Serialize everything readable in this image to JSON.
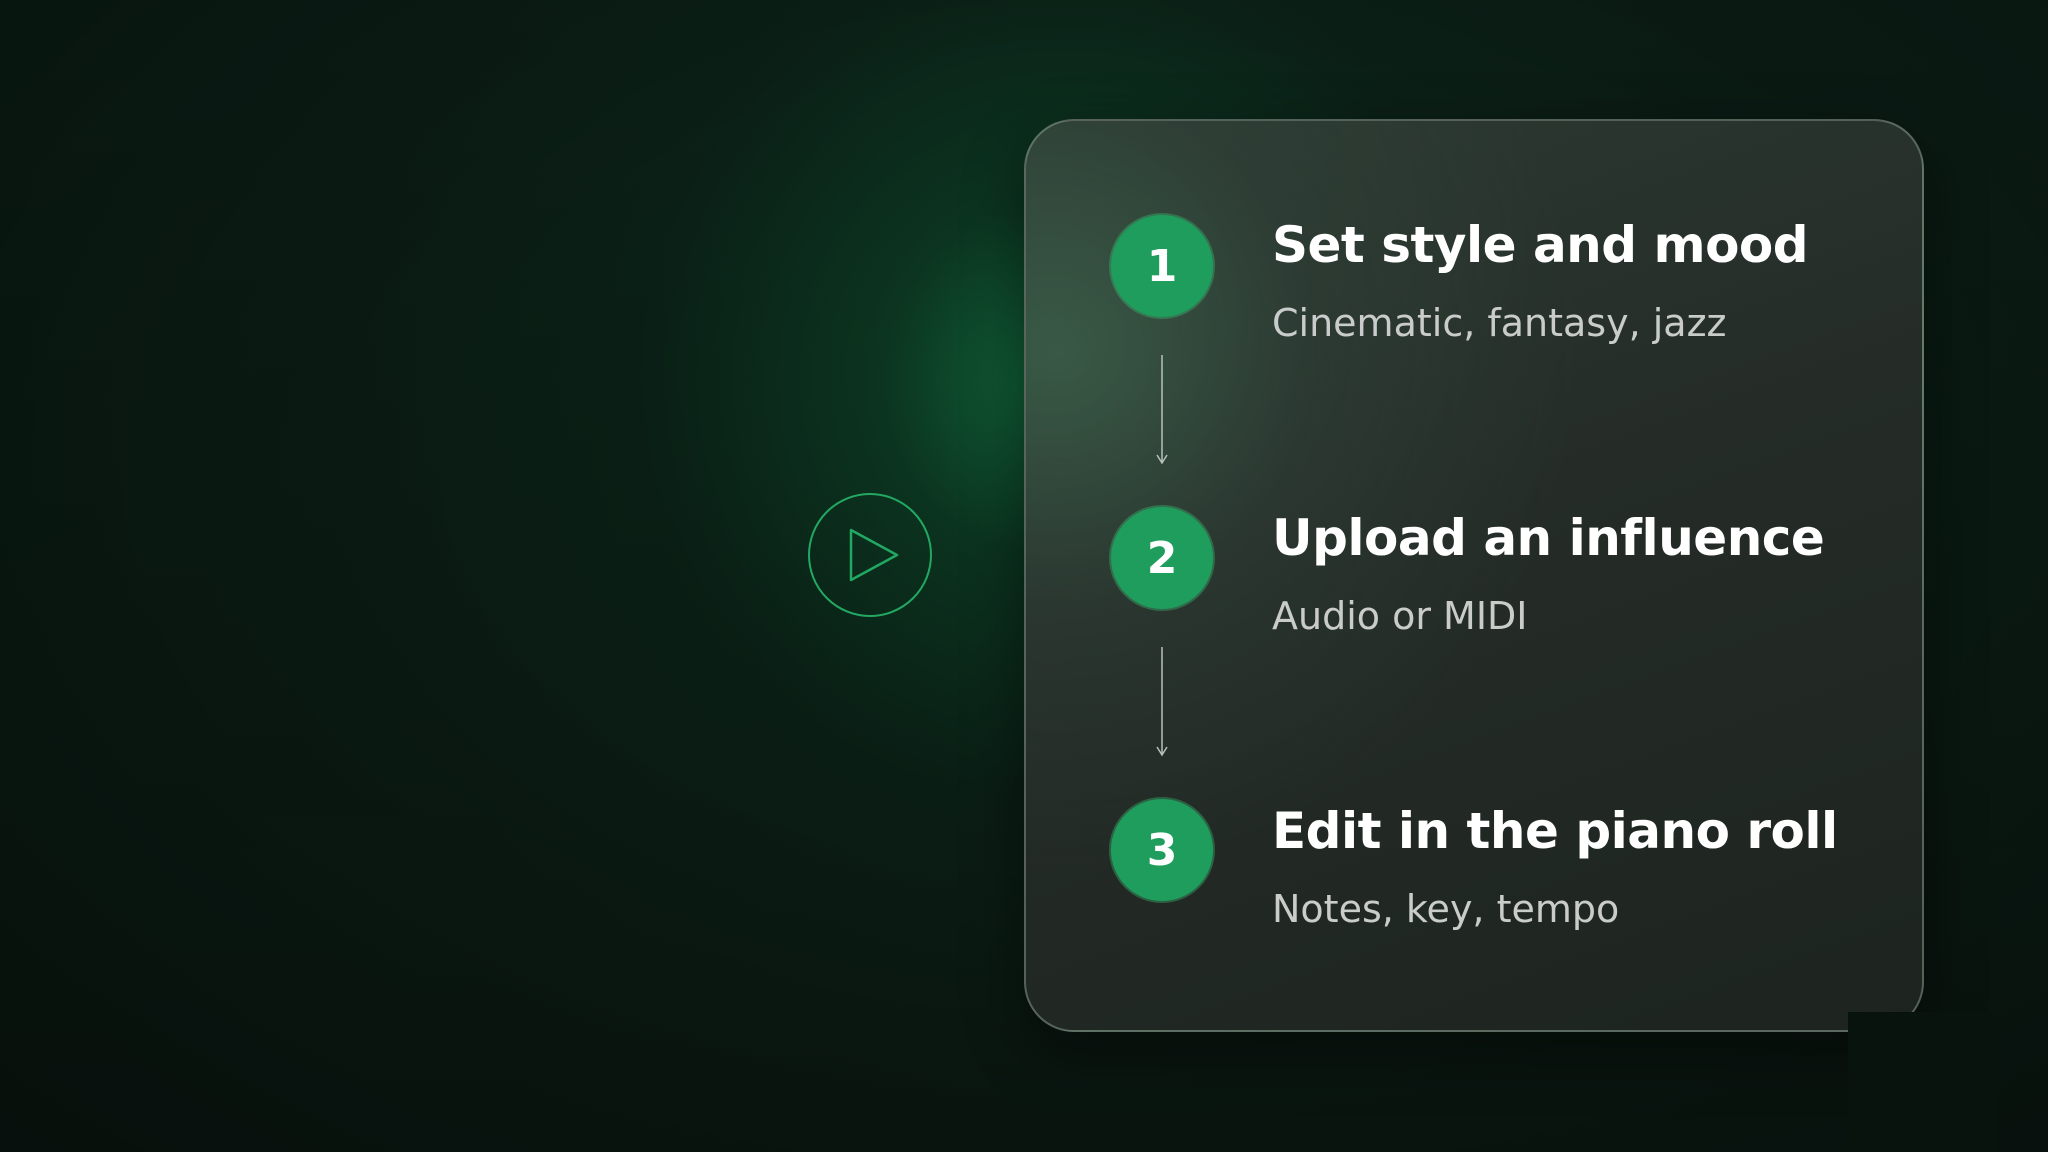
{
  "play": {
    "icon": "play-icon",
    "accent_color": "#22a862"
  },
  "steps": [
    {
      "number": "1",
      "title": "Set style and mood",
      "subtitle": "Cinematic, fantasy, jazz"
    },
    {
      "number": "2",
      "title": "Upload an influence",
      "subtitle": "Audio or MIDI"
    },
    {
      "number": "3",
      "title": "Edit in the piano roll",
      "subtitle": "Notes, key, tempo"
    }
  ],
  "colors": {
    "badge": "#1f9d5c",
    "background": "#0a1a12",
    "card": "#252c28"
  },
  "connector_icon": "arrow-down-icon"
}
